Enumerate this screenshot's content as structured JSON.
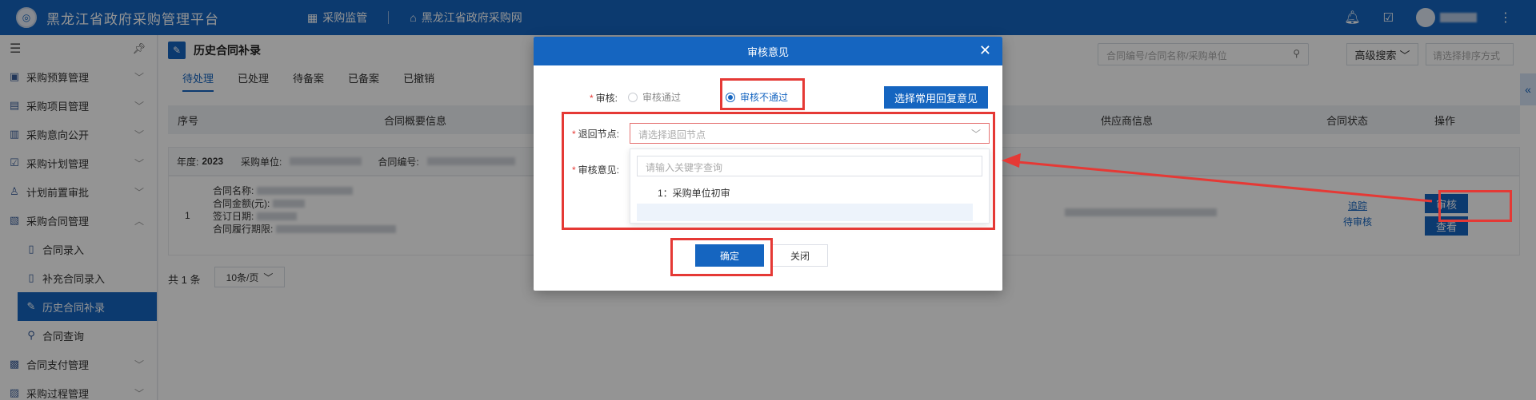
{
  "topbar": {
    "app_title": "黑龙江省政府采购管理平台",
    "logo_text": "◎",
    "nav": [
      "采购监管",
      "黑龙江省政府采购网"
    ],
    "user_name": ""
  },
  "sidebar": {
    "items": [
      {
        "label": "采购预算管理"
      },
      {
        "label": "采购项目管理"
      },
      {
        "label": "采购意向公开"
      },
      {
        "label": "采购计划管理"
      },
      {
        "label": "计划前置审批"
      },
      {
        "label": "采购合同管理"
      },
      {
        "label": "合同支付管理"
      },
      {
        "label": "采购过程管理"
      }
    ],
    "sub_items": [
      {
        "label": "合同录入"
      },
      {
        "label": "补充合同录入"
      },
      {
        "label": "历史合同补录"
      },
      {
        "label": "合同查询"
      }
    ]
  },
  "page": {
    "title": "历史合同补录",
    "tabs": [
      "待处理",
      "已处理",
      "待备案",
      "已备案",
      "已撤销"
    ],
    "search_placeholder": "合同编号/合同名称/采购单位",
    "advanced_search": "高级搜索",
    "sort_placeholder": "请选择排序方式",
    "table_headers": [
      "序号",
      "合同概要信息",
      "供应商信息",
      "合同状态",
      "操作"
    ],
    "group": {
      "year_label": "年度:",
      "year_value": "2023",
      "unit_label": "采购单位:",
      "code_label": "合同编号:"
    },
    "row": {
      "seq": "1",
      "name_label": "合同名称:",
      "amount_label": "合同金额(元):",
      "sign_date_label": "签订日期:",
      "period_label": "合同履行期限:",
      "track_link": "追踪",
      "status": "待审核",
      "review_btn": "审核",
      "view_btn": "查看"
    },
    "total": "共 1 条",
    "page_size": "10条/页"
  },
  "modal": {
    "title": "审核意见",
    "review_label": "审核:",
    "option_pass": "审核通过",
    "option_reject": "审核不通过",
    "reply_btn": "选择常用回复意见",
    "return_node_label": "退回节点:",
    "return_node_placeholder": "请选择退回节点",
    "opinion_label": "审核意见:",
    "dd_search_placeholder": "请输入关键字查询",
    "dd_option": "1：采购单位初审",
    "confirm_btn": "确定",
    "close_btn": "关闭"
  },
  "colors": {
    "brand": "#1565c0",
    "annotation": "#e53935"
  }
}
